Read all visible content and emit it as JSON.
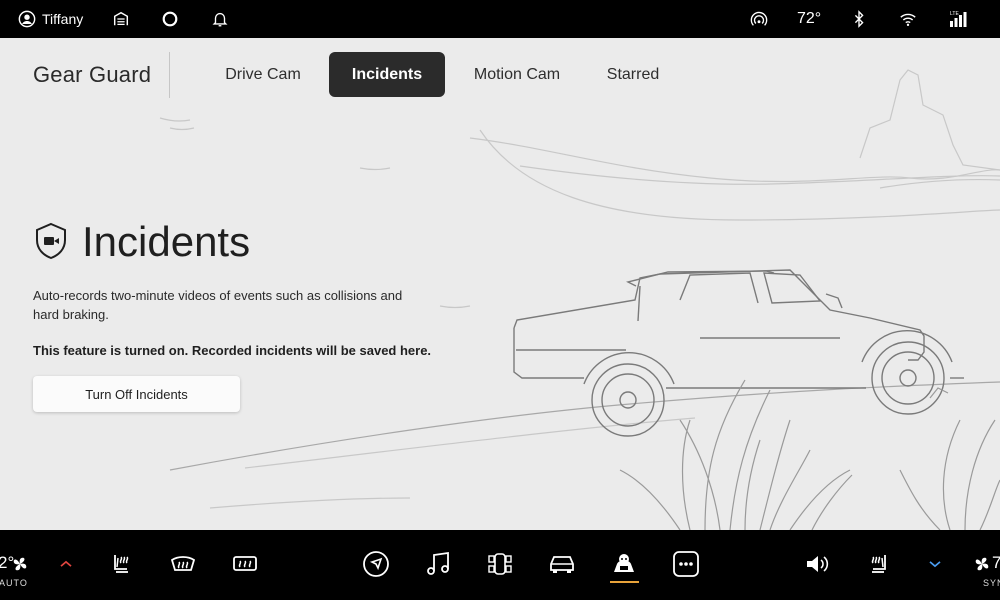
{
  "status_bar": {
    "user_name": "Tiffany",
    "temperature": "72°",
    "signal_label": "LTE",
    "icons": [
      "user-icon",
      "garage-icon",
      "assistant-icon",
      "bell-icon",
      "hotspot-icon",
      "bluetooth-icon",
      "wifi-icon",
      "cellular-icon"
    ]
  },
  "header": {
    "app_title": "Gear Guard",
    "tabs": [
      {
        "label": "Drive Cam",
        "active": false
      },
      {
        "label": "Incidents",
        "active": true
      },
      {
        "label": "Motion Cam",
        "active": false
      },
      {
        "label": "Starred",
        "active": false
      }
    ]
  },
  "content": {
    "icon": "shield-camera-icon",
    "title": "Incidents",
    "description": "Auto-records two-minute videos of events such as collisions and hard braking.",
    "status_note": "This feature is turned on. Recorded incidents will be saved here.",
    "action_label": "Turn Off Incidents"
  },
  "dock": {
    "left_temp": "2°",
    "left_mode": "AUTO",
    "right_temp": "7",
    "right_mode": "SYN",
    "items": [
      "fan-icon",
      "chevron-up-icon",
      "seat-heat-icon",
      "front-defrost-icon",
      "rear-defrost-icon",
      "navigation-icon",
      "music-icon",
      "vehicle-controls-icon",
      "car-icon",
      "gear-guard-icon",
      "more-icon",
      "volume-icon",
      "seat-heat-right-icon",
      "chevron-down-icon",
      "fan-right-icon"
    ],
    "colors": {
      "temp_up": "#e0453f",
      "temp_down": "#4a9cf0",
      "active_underline": "#e8a33a"
    }
  }
}
